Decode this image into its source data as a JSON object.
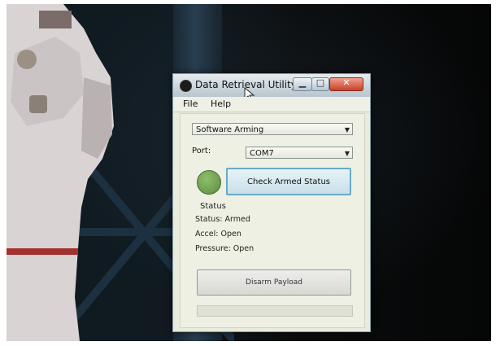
{
  "window": {
    "title": "Data Retrieval Utility"
  },
  "menu": {
    "file": "File",
    "help": "Help"
  },
  "mode_select": {
    "value": "Software Arming"
  },
  "port": {
    "label": "Port:",
    "value": "COM7"
  },
  "check_button": {
    "label": "Check Armed Status"
  },
  "indicator": {
    "color": "#6a9c4c"
  },
  "status": {
    "group_title": "Status",
    "status_line": "Status: Armed",
    "accel_line": "Accel: Open",
    "pressure_line": "Pressure: Open"
  },
  "disarm_button": {
    "label": "Disarm Payload"
  },
  "progress": {
    "value": 0
  },
  "icons": {
    "app": "app-icon",
    "minimize": "minimize-icon",
    "maximize": "maximize-icon",
    "close": "close-icon",
    "dropdown": "chevron-down-icon",
    "cursor": "mouse-cursor-icon"
  }
}
